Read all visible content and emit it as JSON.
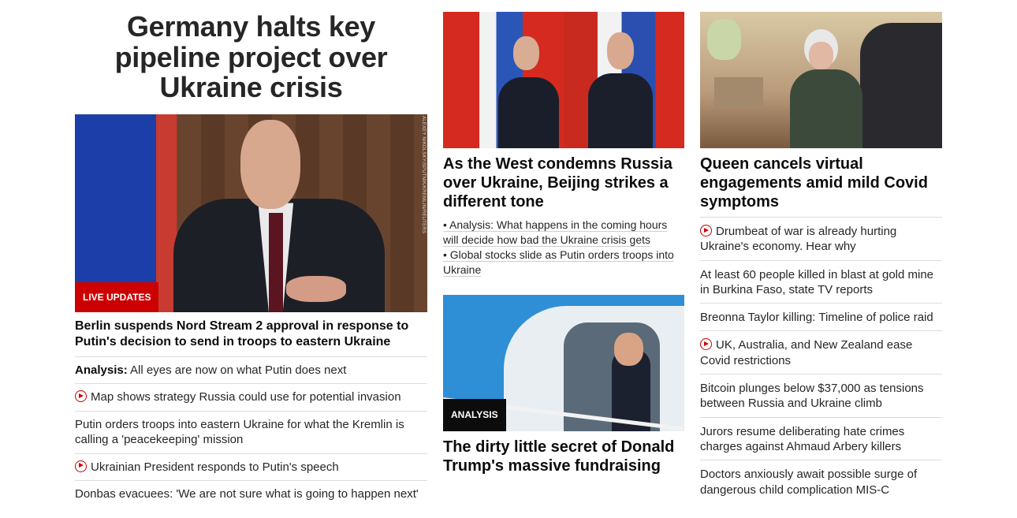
{
  "col1": {
    "headline": "Germany halts key pipeline project over Ukraine crisis",
    "image_credit": "ALEXEY NIKOLSKY/SPUTNIK/KREMLIN/REUTERS",
    "badge": "LIVE UPDATES",
    "lead_title": "Berlin suspends Nord Stream 2 approval in response to Putin's decision to send in troops to eastern Ukraine",
    "links": [
      {
        "prefix": "Analysis:",
        "text": "All eyes are now on what Putin does next",
        "video": false
      },
      {
        "prefix": "",
        "text": "Map shows strategy Russia could use for potential invasion",
        "video": true
      },
      {
        "prefix": "",
        "text": "Putin orders troops into eastern Ukraine for what the Kremlin is calling a 'peacekeeping' mission",
        "video": false
      },
      {
        "prefix": "",
        "text": "Ukrainian President responds to Putin's speech",
        "video": true
      },
      {
        "prefix": "",
        "text": "Donbas evacuees: 'We are not sure what is going to happen next'",
        "video": false
      }
    ]
  },
  "col2": {
    "card1": {
      "title": "As the West condemns Russia over Ukraine, Beijing strikes a different tone",
      "sub_links": [
        "• Analysis: What happens in the coming hours will decide how bad the Ukraine crisis gets",
        "• Global stocks slide as Putin orders troops into Ukraine"
      ]
    },
    "card2": {
      "badge": "ANALYSIS",
      "title": "The dirty little secret of Donald Trump's massive fundraising"
    }
  },
  "col3": {
    "title": "Queen cancels virtual engagements amid mild Covid symptoms",
    "links": [
      {
        "text": "Drumbeat of war is already hurting Ukraine's economy. Hear why",
        "video": true
      },
      {
        "text": "At least 60 people killed in blast at gold mine in Burkina Faso, state TV reports",
        "video": false
      },
      {
        "text": "Breonna Taylor killing: Timeline of police raid",
        "video": false
      },
      {
        "text": "UK, Australia, and New Zealand ease Covid restrictions",
        "video": true
      },
      {
        "text": "Bitcoin plunges below $37,000 as tensions between Russia and Ukraine climb",
        "video": false
      },
      {
        "text": "Jurors resume deliberating hate crimes charges against Ahmaud Arbery killers",
        "video": false
      },
      {
        "text": "Doctors anxiously await possible surge of dangerous child complication MIS-C",
        "video": false
      }
    ]
  },
  "colors": {
    "accent_red": "#cc0000",
    "badge_dark": "#0c0c0c",
    "divider": "#dcdcdc"
  }
}
